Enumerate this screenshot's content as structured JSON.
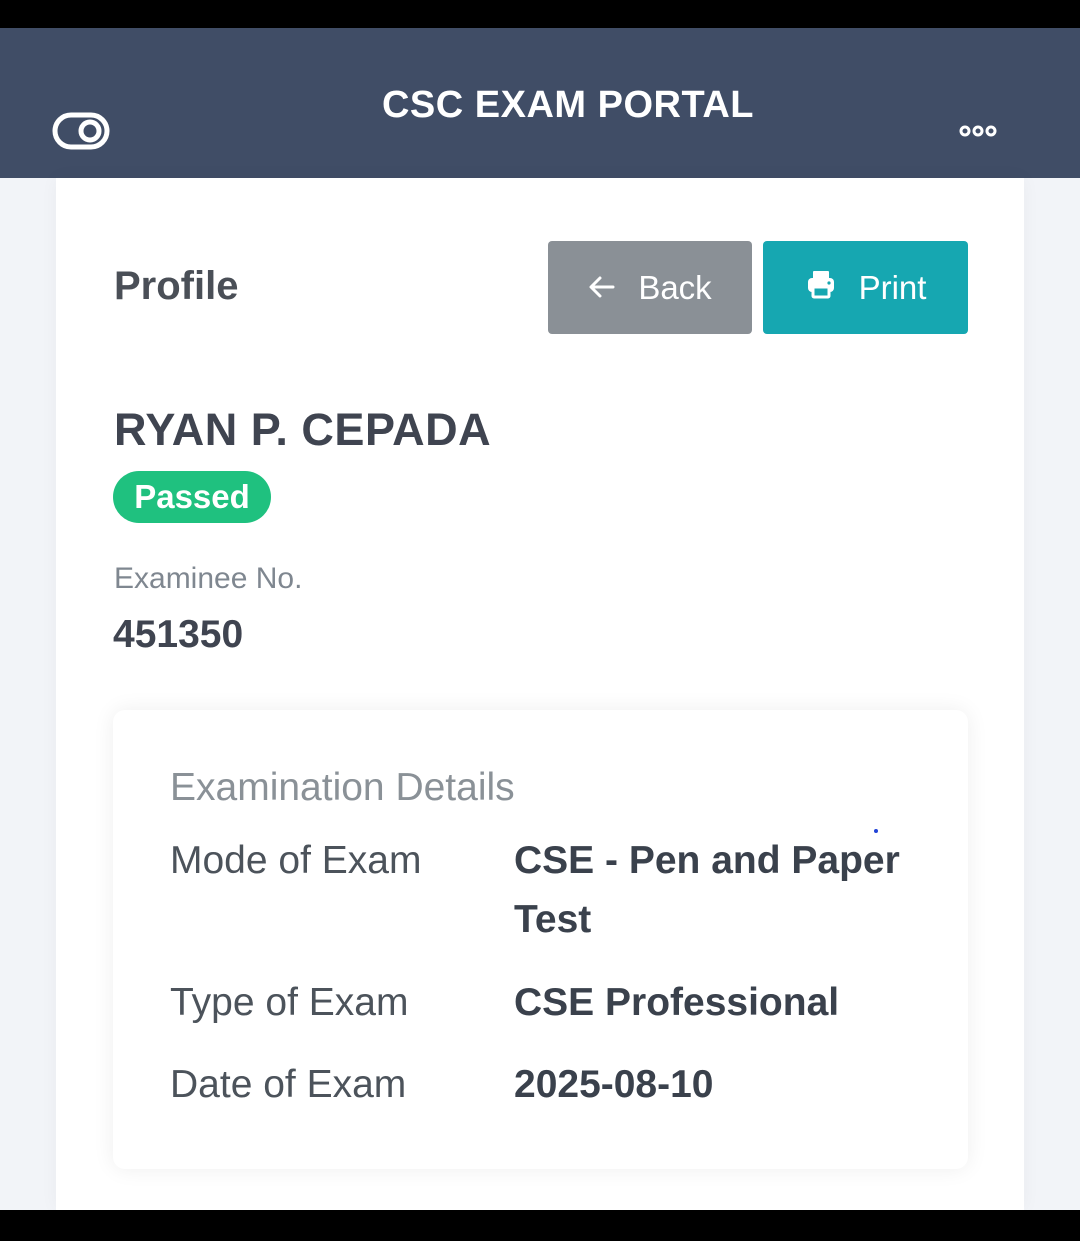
{
  "header": {
    "title": "CSC EXAM PORTAL",
    "left_icon": "toggle-icon",
    "right_icon": "more-options-icon",
    "background": "#404d66"
  },
  "profile": {
    "title": "Profile",
    "back_label": "Back",
    "print_label": "Print",
    "name": "RYAN P. CEPADA",
    "status_badge": "Passed",
    "examinee_no_label": "Examinee No.",
    "examinee_no_value": "451350"
  },
  "details": {
    "title": "Examination Details",
    "rows": [
      {
        "label": "Mode of Exam",
        "value": "CSE - Pen and Paper Test"
      },
      {
        "label": "Type of Exam",
        "value": "CSE Professional"
      },
      {
        "label": "Date of Exam",
        "value": "2025-08-10"
      }
    ]
  },
  "colors": {
    "back_button": "#8a9096",
    "print_button": "#16a7b1",
    "passed_badge": "#1fc17f"
  }
}
